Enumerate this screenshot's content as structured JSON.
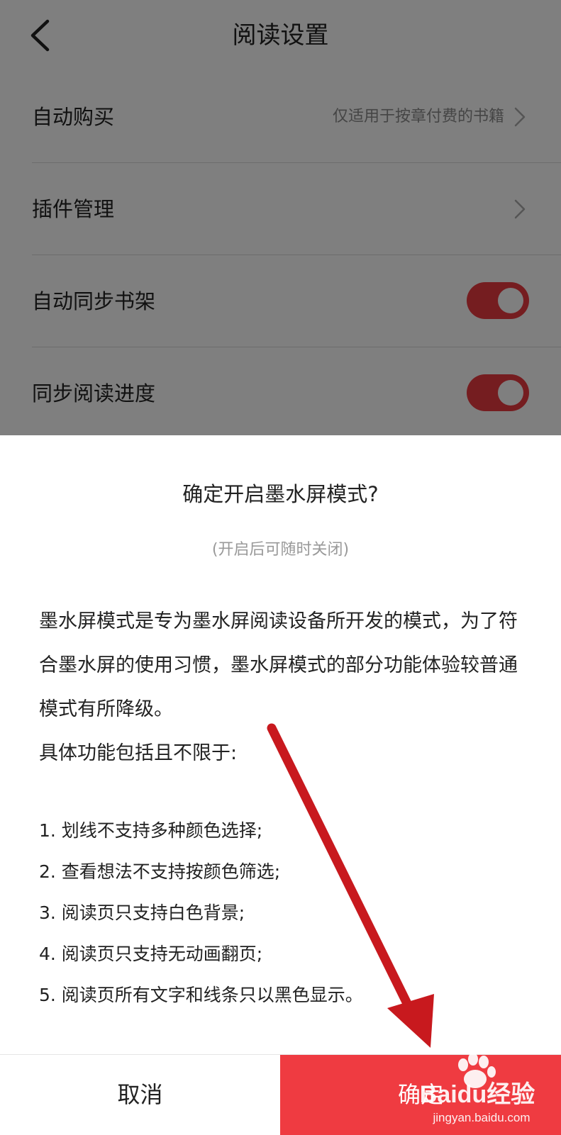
{
  "header": {
    "title": "阅读设置",
    "back_icon": "chevron-left-icon"
  },
  "settings": {
    "auto_purchase": {
      "label": "自动购买",
      "hint": "仅适用于按章付费的书籍"
    },
    "plugin_management": {
      "label": "插件管理"
    },
    "auto_sync_shelf": {
      "label": "自动同步书架",
      "enabled": true
    },
    "sync_progress": {
      "label": "同步阅读进度",
      "enabled": true
    }
  },
  "dialog": {
    "title": "确定开启墨水屏模式?",
    "subtitle": "(开启后可随时关闭)",
    "body": [
      "墨水屏模式是专为墨水屏阅读设备所开发的模式，为了符合墨水屏的使用习惯，墨水屏模式的部分功能体验较普通模式有所降级。",
      "具体功能包括且不限于:"
    ],
    "items": [
      "1. 划线不支持多种颜色选择;",
      "2. 查看想法不支持按颜色筛选;",
      "3. 阅读页只支持白色背景;",
      "4. 阅读页只支持无动画翻页;",
      "5. 阅读页所有文字和线条只以黑色显示。"
    ],
    "cancel_label": "取消",
    "confirm_label": "确定"
  },
  "watermark": {
    "text": "Baidu经验",
    "url": "jingyan.baidu.com"
  },
  "colors": {
    "accent": "#ef3b41",
    "annotation_arrow": "#c8191e"
  }
}
